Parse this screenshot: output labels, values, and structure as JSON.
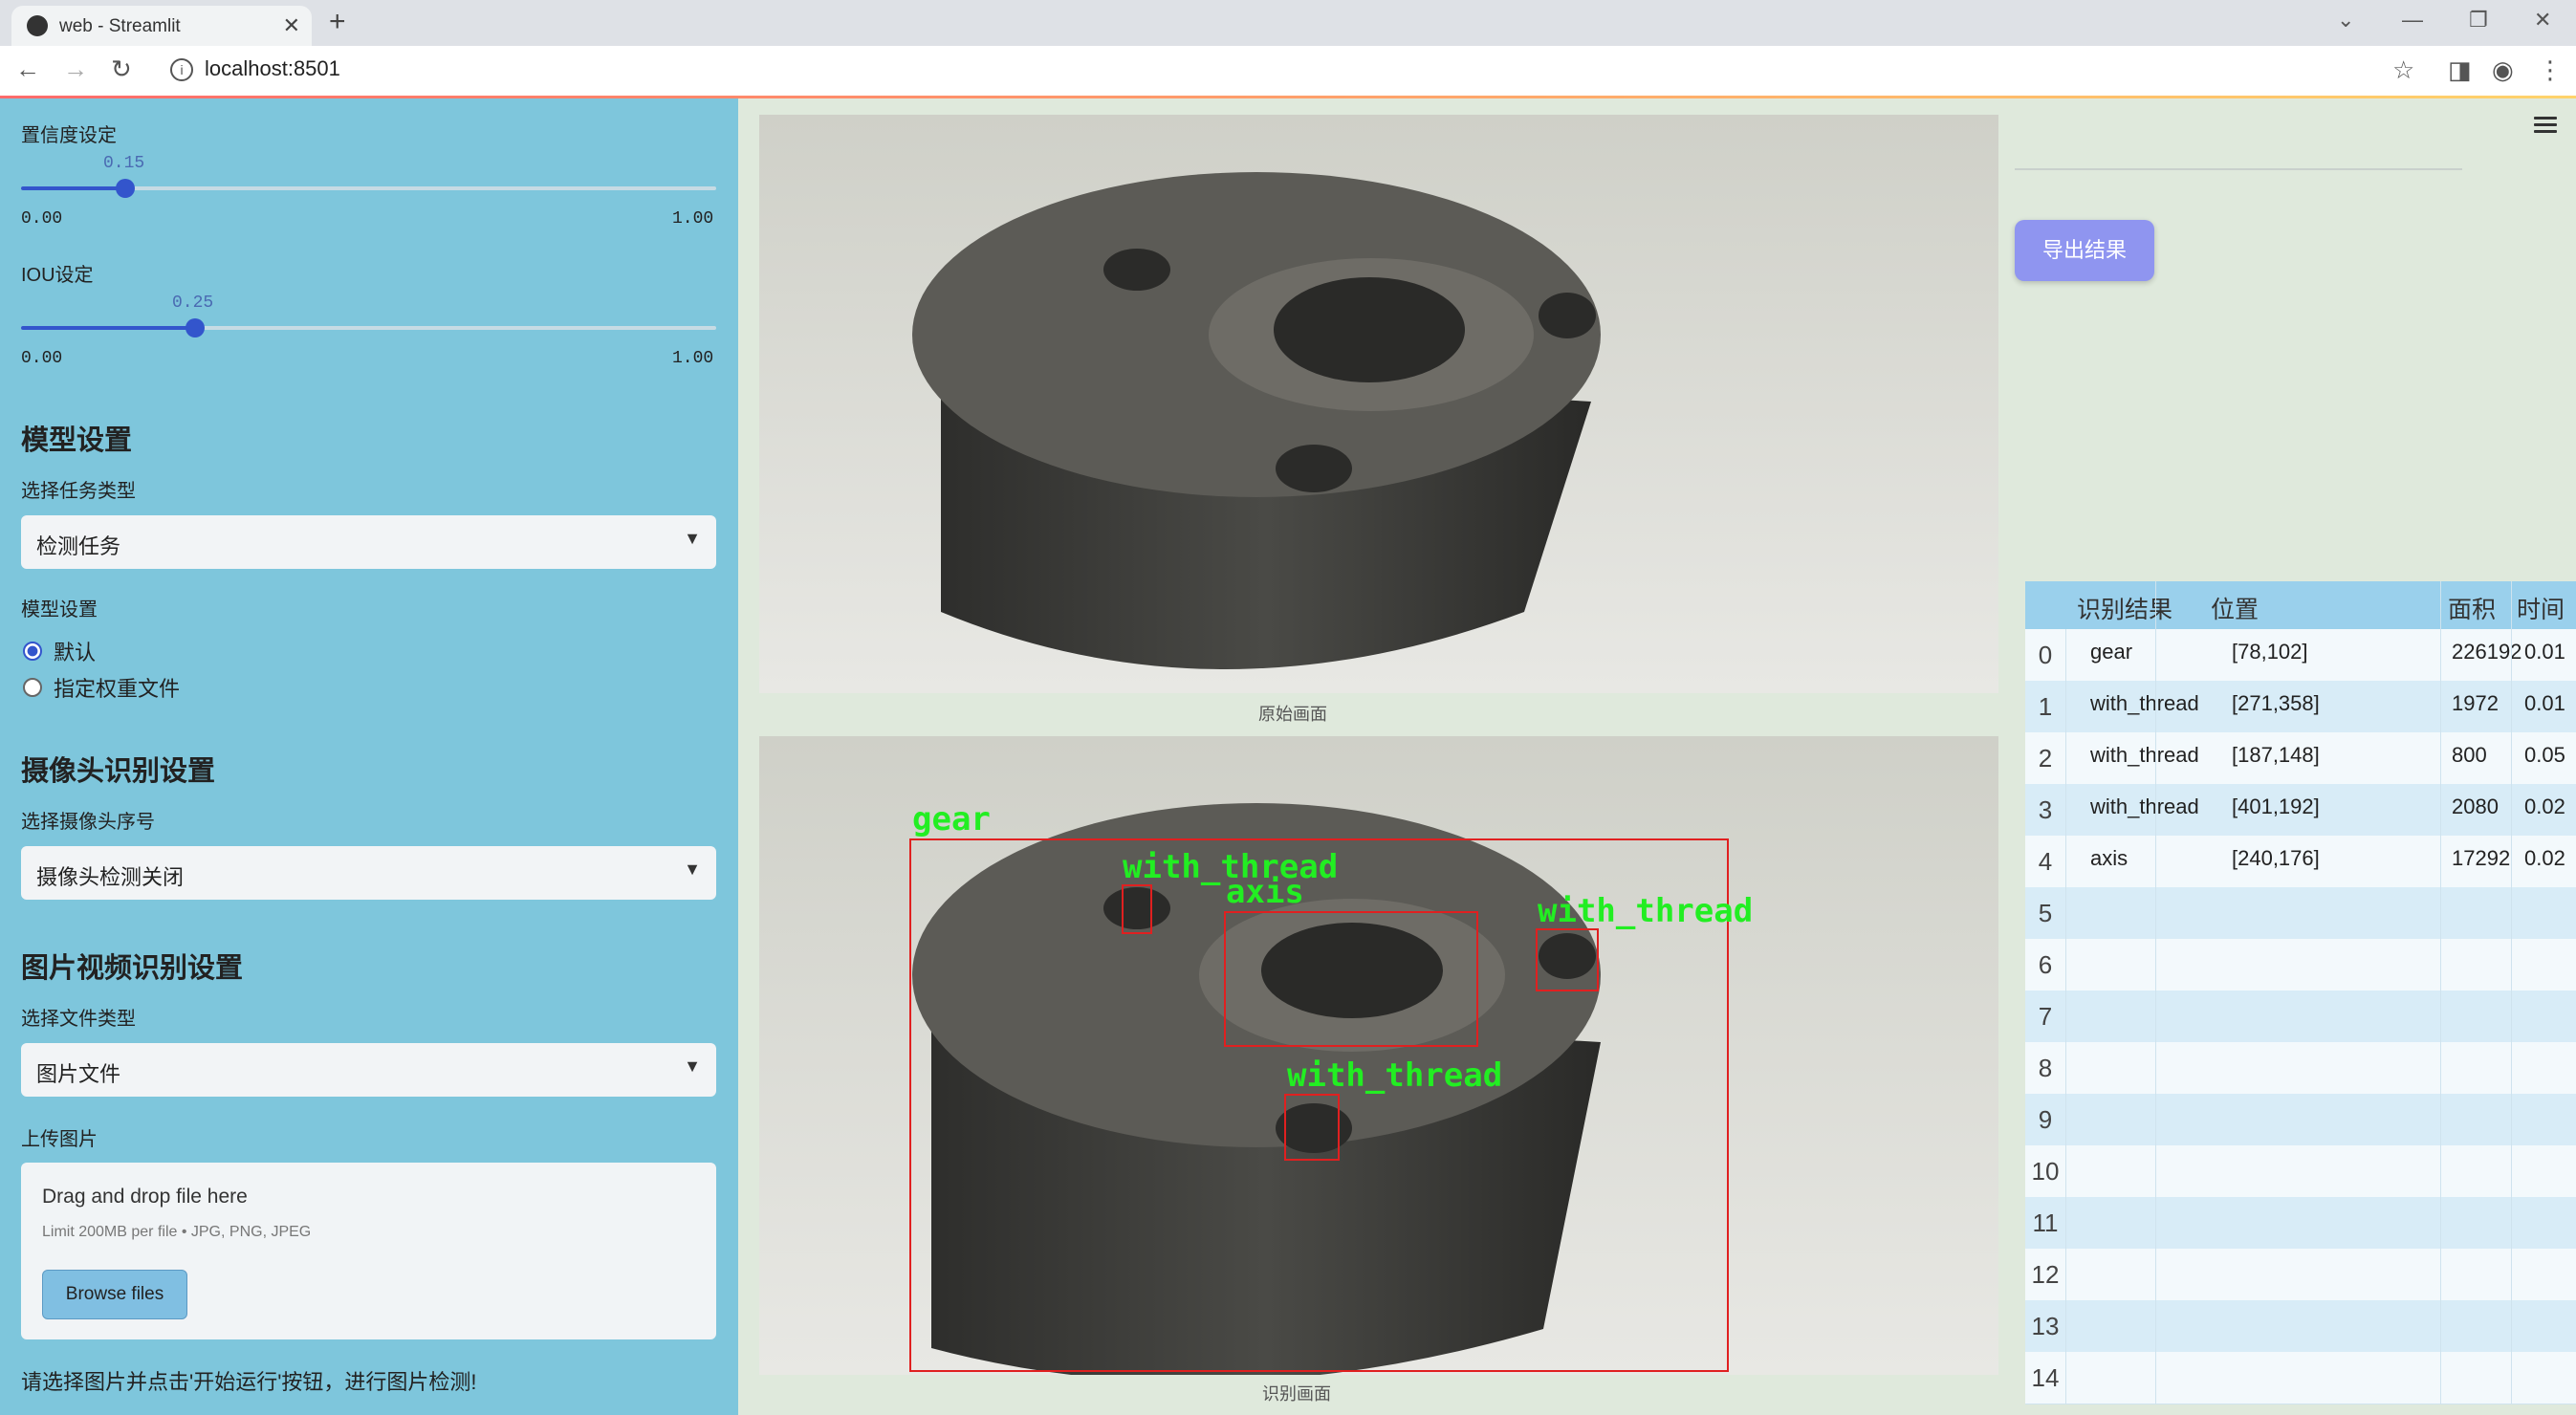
{
  "browser": {
    "tab_title": "web - Streamlit",
    "tab_close": "✕",
    "new_tab": "+",
    "url": "localhost:8501"
  },
  "sidebar": {
    "confidence": {
      "label": "置信度设定",
      "value": "0.15",
      "value_num": 0.15,
      "min": "0.00",
      "max": "1.00"
    },
    "iou": {
      "label": "IOU设定",
      "value": "0.25",
      "value_num": 0.25,
      "min": "0.00",
      "max": "1.00"
    },
    "model_section": {
      "heading": "模型设置",
      "task_label": "选择任务类型",
      "task_value": "检测任务",
      "model_label": "模型设置",
      "options": [
        "默认",
        "指定权重文件"
      ],
      "selected": "默认"
    },
    "camera_section": {
      "heading": "摄像头识别设置",
      "label": "选择摄像头序号",
      "value": "摄像头检测关闭"
    },
    "media_section": {
      "heading": "图片视频识别设置",
      "file_type_label": "选择文件类型",
      "file_type_value": "图片文件",
      "upload_label": "上传图片",
      "drag_text": "Drag and drop file here",
      "limit_text": "Limit 200MB per file • JPG, PNG, JPEG",
      "browse_label": "Browse files"
    },
    "hint": "请选择图片并点击'开始运行'按钮，进行图片检测!"
  },
  "main": {
    "original_caption": "原始画面",
    "result_caption": "识别画面",
    "export_label": "导出结果",
    "detections": [
      "gear",
      "with_thread",
      "axis",
      "with_thread",
      "with_thread"
    ]
  },
  "table": {
    "headers": [
      "识别结果",
      "位置",
      "面积",
      "时间"
    ],
    "rows": [
      {
        "idx": "0",
        "label": "gear",
        "pos": "[78,102]",
        "area": "226192",
        "time": "0.01"
      },
      {
        "idx": "1",
        "label": "with_thread",
        "pos": "[271,358]",
        "area": "1972",
        "time": "0.01"
      },
      {
        "idx": "2",
        "label": "with_thread",
        "pos": "[187,148]",
        "area": "800",
        "time": "0.05"
      },
      {
        "idx": "3",
        "label": "with_thread",
        "pos": "[401,192]",
        "area": "2080",
        "time": "0.02"
      },
      {
        "idx": "4",
        "label": "axis",
        "pos": "[240,176]",
        "area": "17292",
        "time": "0.02"
      },
      {
        "idx": "5",
        "label": "",
        "pos": "",
        "area": "",
        "time": ""
      },
      {
        "idx": "6",
        "label": "",
        "pos": "",
        "area": "",
        "time": ""
      },
      {
        "idx": "7",
        "label": "",
        "pos": "",
        "area": "",
        "time": ""
      },
      {
        "idx": "8",
        "label": "",
        "pos": "",
        "area": "",
        "time": ""
      },
      {
        "idx": "9",
        "label": "",
        "pos": "",
        "area": "",
        "time": ""
      },
      {
        "idx": "10",
        "label": "",
        "pos": "",
        "area": "",
        "time": ""
      },
      {
        "idx": "11",
        "label": "",
        "pos": "",
        "area": "",
        "time": ""
      },
      {
        "idx": "12",
        "label": "",
        "pos": "",
        "area": "",
        "time": ""
      },
      {
        "idx": "13",
        "label": "",
        "pos": "",
        "area": "",
        "time": ""
      },
      {
        "idx": "14",
        "label": "",
        "pos": "",
        "area": "",
        "time": ""
      }
    ]
  },
  "colors": {
    "sidebar": "#7ec6dc",
    "accent": "#3355cc",
    "export_button": "#8f95f0",
    "box": "#e02020",
    "box_label": "#22ee22"
  }
}
